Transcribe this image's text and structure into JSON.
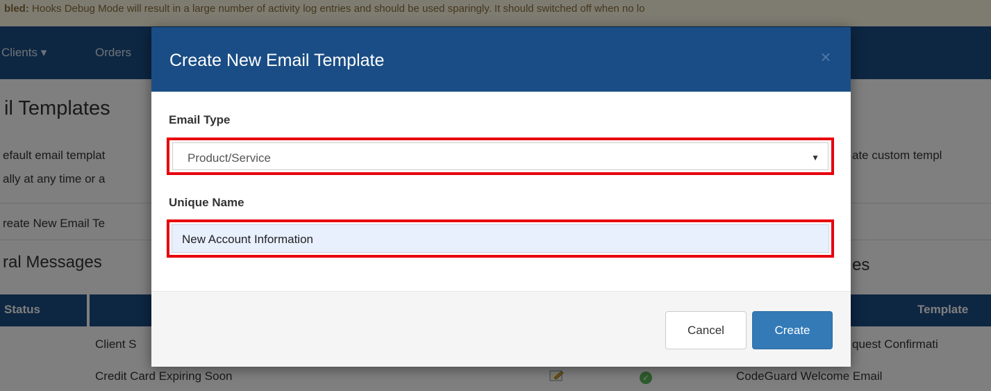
{
  "warning_bar": {
    "prefix": "bled:",
    "message": "Hooks Debug Mode will result in a large number of activity log entries and should be used sparingly. It should switched off when no lo"
  },
  "navbar": {
    "clients_label": "Clients",
    "clients_caret": "▾",
    "orders_label": "Orders"
  },
  "page": {
    "title": "il Templates",
    "desc_line1_left": "efault email templat",
    "desc_line1_right": "ate custom templ",
    "desc_line2_left": "ally at any time or a",
    "create_link": "reate New Email Te",
    "general_messages_title": "ral Messages",
    "right_section_title": "es"
  },
  "table": {
    "status_header": "Status",
    "template_header": "Template",
    "rows_left": [
      "Client S",
      "Credit Card Expiring Soon"
    ],
    "rows_right": [
      "quest Confirmati",
      "CodeGuard Welcome Email"
    ]
  },
  "modal": {
    "title": "Create New Email Template",
    "close_glyph": "×",
    "email_type_label": "Email Type",
    "email_type_value": "Product/Service",
    "email_type_caret": "▼",
    "unique_name_label": "Unique Name",
    "unique_name_value": "New Account Information",
    "cancel_label": "Cancel",
    "create_label": "Create"
  },
  "icons": {
    "edit": "pencil-icon",
    "active": "check-circle-icon"
  },
  "colors": {
    "brand_blue": "#1a4d85",
    "primary_button": "#337ab7",
    "highlight_red": "#e8000b",
    "warning_bg": "#fcf8e3"
  }
}
